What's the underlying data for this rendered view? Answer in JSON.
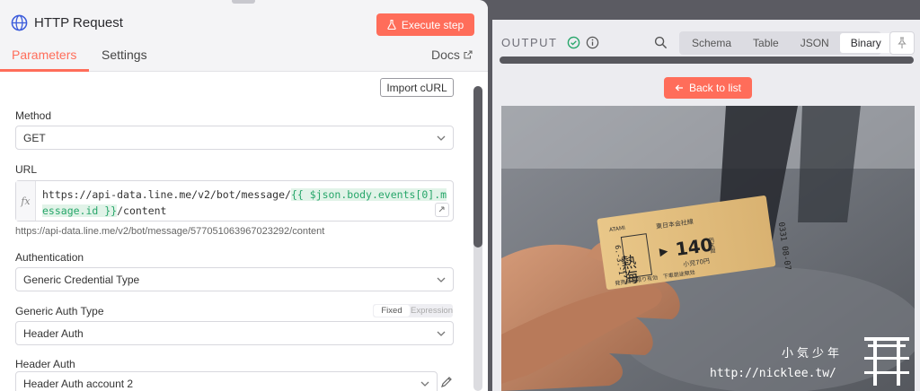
{
  "node": {
    "title": "HTTP Request",
    "execute_label": "Execute step"
  },
  "tabs": {
    "parameters": "Parameters",
    "settings": "Settings",
    "docs": "Docs"
  },
  "params": {
    "import_label": "Import cURL",
    "method_label": "Method",
    "method_value": "GET",
    "url_label": "URL",
    "url_prefix": "https://api-data.line.me/v2/bot/message/",
    "url_expression": "{{ $json.body.events[0].message.id }}",
    "url_suffix": "/content",
    "url_resolved": "https://api-data.line.me/v2/bot/message/577051063967023292/content",
    "auth_label": "Authentication",
    "auth_value": "Generic Credential Type",
    "generic_label": "Generic Auth Type",
    "generic_value": "Header Auth",
    "toggle_fixed": "Fixed",
    "toggle_expression": "Expression",
    "header_auth_label": "Header Auth",
    "header_auth_value": "Header Auth account 2"
  },
  "output": {
    "label": "OUTPUT",
    "view_tabs": [
      "Schema",
      "Table",
      "JSON",
      "Binary"
    ],
    "active_tab": "Binary",
    "back_label": "Back to list"
  },
  "ticket": {
    "station_small": "ATAMI",
    "station": "熱海",
    "company": "東日本会社線",
    "price": "140",
    "unit": "円区間",
    "child": "小児70円",
    "date_code": "6.-3.-1",
    "serial": "0331 08-07",
    "footer": "発売当日限り有効　下車前途無効"
  },
  "watermark": {
    "top": "小気少年",
    "url": "http://nicklee.tw/"
  },
  "colors": {
    "accent": "#ff6d5a",
    "success": "#27a66a"
  }
}
